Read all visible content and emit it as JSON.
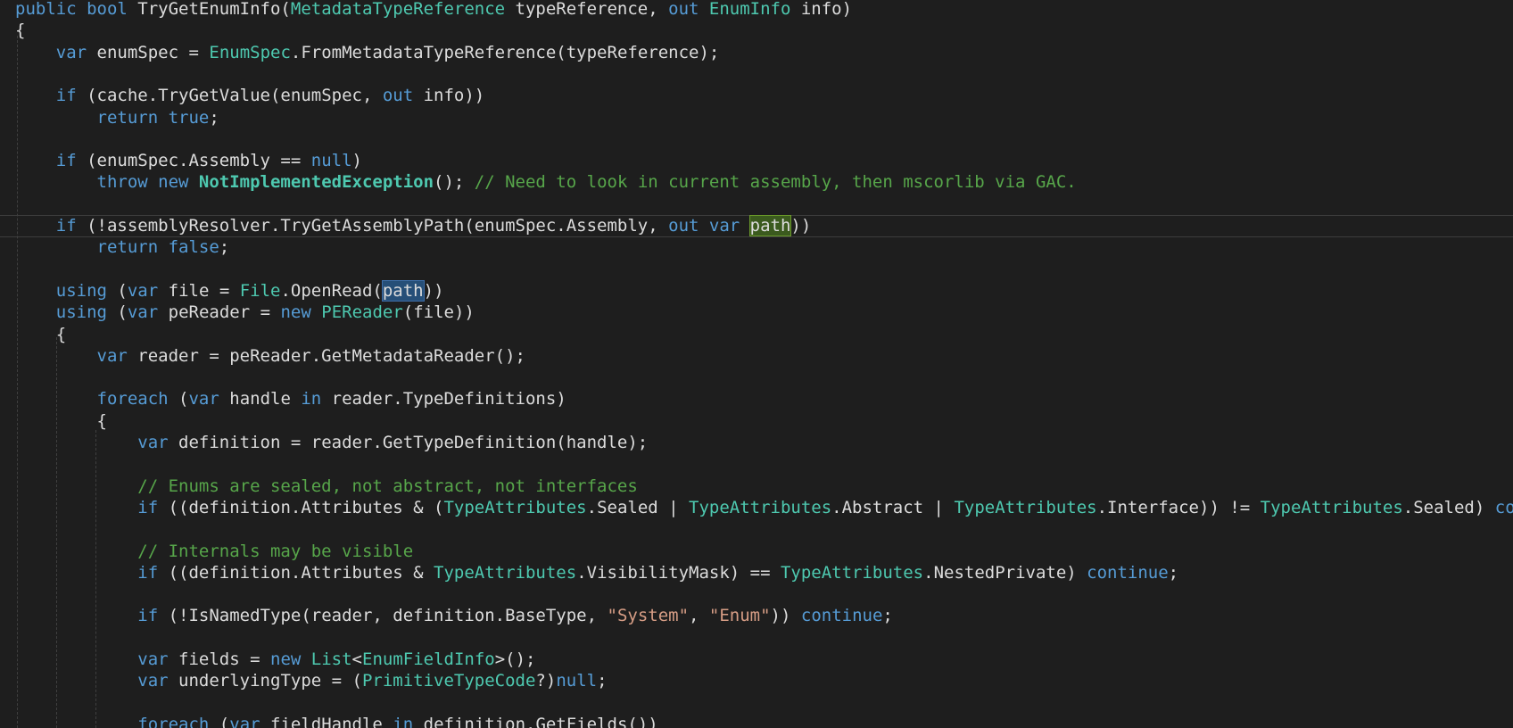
{
  "colors": {
    "background": "#1e1e1e",
    "text": "#dcdcdc",
    "keyword": "#569cd6",
    "type": "#4ec9b0",
    "comment": "#57a64a",
    "string": "#d69d85",
    "highlight_definition": "#3b5a1e",
    "highlight_reference": "#264f78"
  },
  "editor": {
    "lines": [
      [
        [
          "kw",
          "public bool"
        ],
        [
          "p",
          " TryGetEnumInfo("
        ],
        [
          "type",
          "MetadataTypeReference"
        ],
        [
          "p",
          " typeReference, "
        ],
        [
          "kw",
          "out"
        ],
        [
          "p",
          " "
        ],
        [
          "type",
          "EnumInfo"
        ],
        [
          "p",
          " info)"
        ]
      ],
      [
        [
          "p",
          "{"
        ]
      ],
      [
        [
          "p",
          "    "
        ],
        [
          "kw",
          "var"
        ],
        [
          "p",
          " enumSpec = "
        ],
        [
          "type",
          "EnumSpec"
        ],
        [
          "p",
          ".FromMetadataTypeReference(typeReference);"
        ]
      ],
      [],
      [
        [
          "p",
          "    "
        ],
        [
          "kw",
          "if"
        ],
        [
          "p",
          " (cache.TryGetValue(enumSpec, "
        ],
        [
          "kw",
          "out"
        ],
        [
          "p",
          " info))"
        ]
      ],
      [
        [
          "p",
          "        "
        ],
        [
          "kw",
          "return true"
        ],
        [
          "p",
          ";"
        ]
      ],
      [],
      [
        [
          "p",
          "    "
        ],
        [
          "kw",
          "if"
        ],
        [
          "p",
          " (enumSpec.Assembly == "
        ],
        [
          "kw",
          "null"
        ],
        [
          "p",
          ")"
        ]
      ],
      [
        [
          "p",
          "        "
        ],
        [
          "kw",
          "throw new"
        ],
        [
          "p",
          " "
        ],
        [
          "exc",
          "NotImplementedException"
        ],
        [
          "p",
          "(); "
        ],
        [
          "com",
          "// Need to look in current assembly, then mscorlib via GAC."
        ]
      ],
      [],
      [
        [
          "p",
          "    "
        ],
        [
          "kw",
          "if"
        ],
        [
          "p",
          " (!assemblyResolver.TryGetAssemblyPath(enumSpec.Assembly, "
        ],
        [
          "kw",
          "out var"
        ],
        [
          "p",
          " "
        ],
        [
          "hldef",
          "path"
        ],
        [
          "p",
          "))"
        ]
      ],
      [
        [
          "p",
          "        "
        ],
        [
          "kw",
          "return false"
        ],
        [
          "p",
          ";"
        ]
      ],
      [],
      [
        [
          "p",
          "    "
        ],
        [
          "kw",
          "using"
        ],
        [
          "p",
          " ("
        ],
        [
          "kw",
          "var"
        ],
        [
          "p",
          " file = "
        ],
        [
          "type",
          "File"
        ],
        [
          "p",
          ".OpenRead("
        ],
        [
          "hlref",
          "path"
        ],
        [
          "p",
          "))"
        ]
      ],
      [
        [
          "p",
          "    "
        ],
        [
          "kw",
          "using"
        ],
        [
          "p",
          " ("
        ],
        [
          "kw",
          "var"
        ],
        [
          "p",
          " peReader = "
        ],
        [
          "kw",
          "new"
        ],
        [
          "p",
          " "
        ],
        [
          "type",
          "PEReader"
        ],
        [
          "p",
          "(file))"
        ]
      ],
      [
        [
          "p",
          "    {"
        ]
      ],
      [
        [
          "p",
          "        "
        ],
        [
          "kw",
          "var"
        ],
        [
          "p",
          " reader = peReader.GetMetadataReader();"
        ]
      ],
      [],
      [
        [
          "p",
          "        "
        ],
        [
          "kw",
          "foreach"
        ],
        [
          "p",
          " ("
        ],
        [
          "kw",
          "var"
        ],
        [
          "p",
          " handle "
        ],
        [
          "kw",
          "in"
        ],
        [
          "p",
          " reader.TypeDefinitions)"
        ]
      ],
      [
        [
          "p",
          "        {"
        ]
      ],
      [
        [
          "p",
          "            "
        ],
        [
          "kw",
          "var"
        ],
        [
          "p",
          " definition = reader.GetTypeDefinition(handle);"
        ]
      ],
      [],
      [
        [
          "p",
          "            "
        ],
        [
          "com",
          "// Enums are sealed, not abstract, not interfaces"
        ]
      ],
      [
        [
          "p",
          "            "
        ],
        [
          "kw",
          "if"
        ],
        [
          "p",
          " ((definition.Attributes & ("
        ],
        [
          "type",
          "TypeAttributes"
        ],
        [
          "p",
          ".Sealed | "
        ],
        [
          "type",
          "TypeAttributes"
        ],
        [
          "p",
          ".Abstract | "
        ],
        [
          "type",
          "TypeAttributes"
        ],
        [
          "p",
          ".Interface)) != "
        ],
        [
          "type",
          "TypeAttributes"
        ],
        [
          "p",
          ".Sealed) "
        ],
        [
          "kw",
          "continue"
        ],
        [
          "p",
          ";"
        ]
      ],
      [],
      [
        [
          "p",
          "            "
        ],
        [
          "com",
          "// Internals may be visible"
        ]
      ],
      [
        [
          "p",
          "            "
        ],
        [
          "kw",
          "if"
        ],
        [
          "p",
          " ((definition.Attributes & "
        ],
        [
          "type",
          "TypeAttributes"
        ],
        [
          "p",
          ".VisibilityMask) == "
        ],
        [
          "type",
          "TypeAttributes"
        ],
        [
          "p",
          ".NestedPrivate) "
        ],
        [
          "kw",
          "continue"
        ],
        [
          "p",
          ";"
        ]
      ],
      [],
      [
        [
          "p",
          "            "
        ],
        [
          "kw",
          "if"
        ],
        [
          "p",
          " (!IsNamedType(reader, definition.BaseType, "
        ],
        [
          "str",
          "\"System\""
        ],
        [
          "p",
          ", "
        ],
        [
          "str",
          "\"Enum\""
        ],
        [
          "p",
          ")) "
        ],
        [
          "kw",
          "continue"
        ],
        [
          "p",
          ";"
        ]
      ],
      [],
      [
        [
          "p",
          "            "
        ],
        [
          "kw",
          "var"
        ],
        [
          "p",
          " fields = "
        ],
        [
          "kw",
          "new"
        ],
        [
          "p",
          " "
        ],
        [
          "type",
          "List"
        ],
        [
          "p",
          "<"
        ],
        [
          "type",
          "EnumFieldInfo"
        ],
        [
          "p",
          ">();"
        ]
      ],
      [
        [
          "p",
          "            "
        ],
        [
          "kw",
          "var"
        ],
        [
          "p",
          " underlyingType = ("
        ],
        [
          "type",
          "PrimitiveTypeCode"
        ],
        [
          "p",
          "?)"
        ],
        [
          "kw",
          "null"
        ],
        [
          "p",
          ";"
        ]
      ],
      [],
      [
        [
          "p",
          "            "
        ],
        [
          "kw",
          "foreach"
        ],
        [
          "p",
          " ("
        ],
        [
          "kw",
          "var"
        ],
        [
          "p",
          " fieldHandle "
        ],
        [
          "kw",
          "in"
        ],
        [
          "p",
          " definition.GetFields())"
        ]
      ]
    ]
  }
}
